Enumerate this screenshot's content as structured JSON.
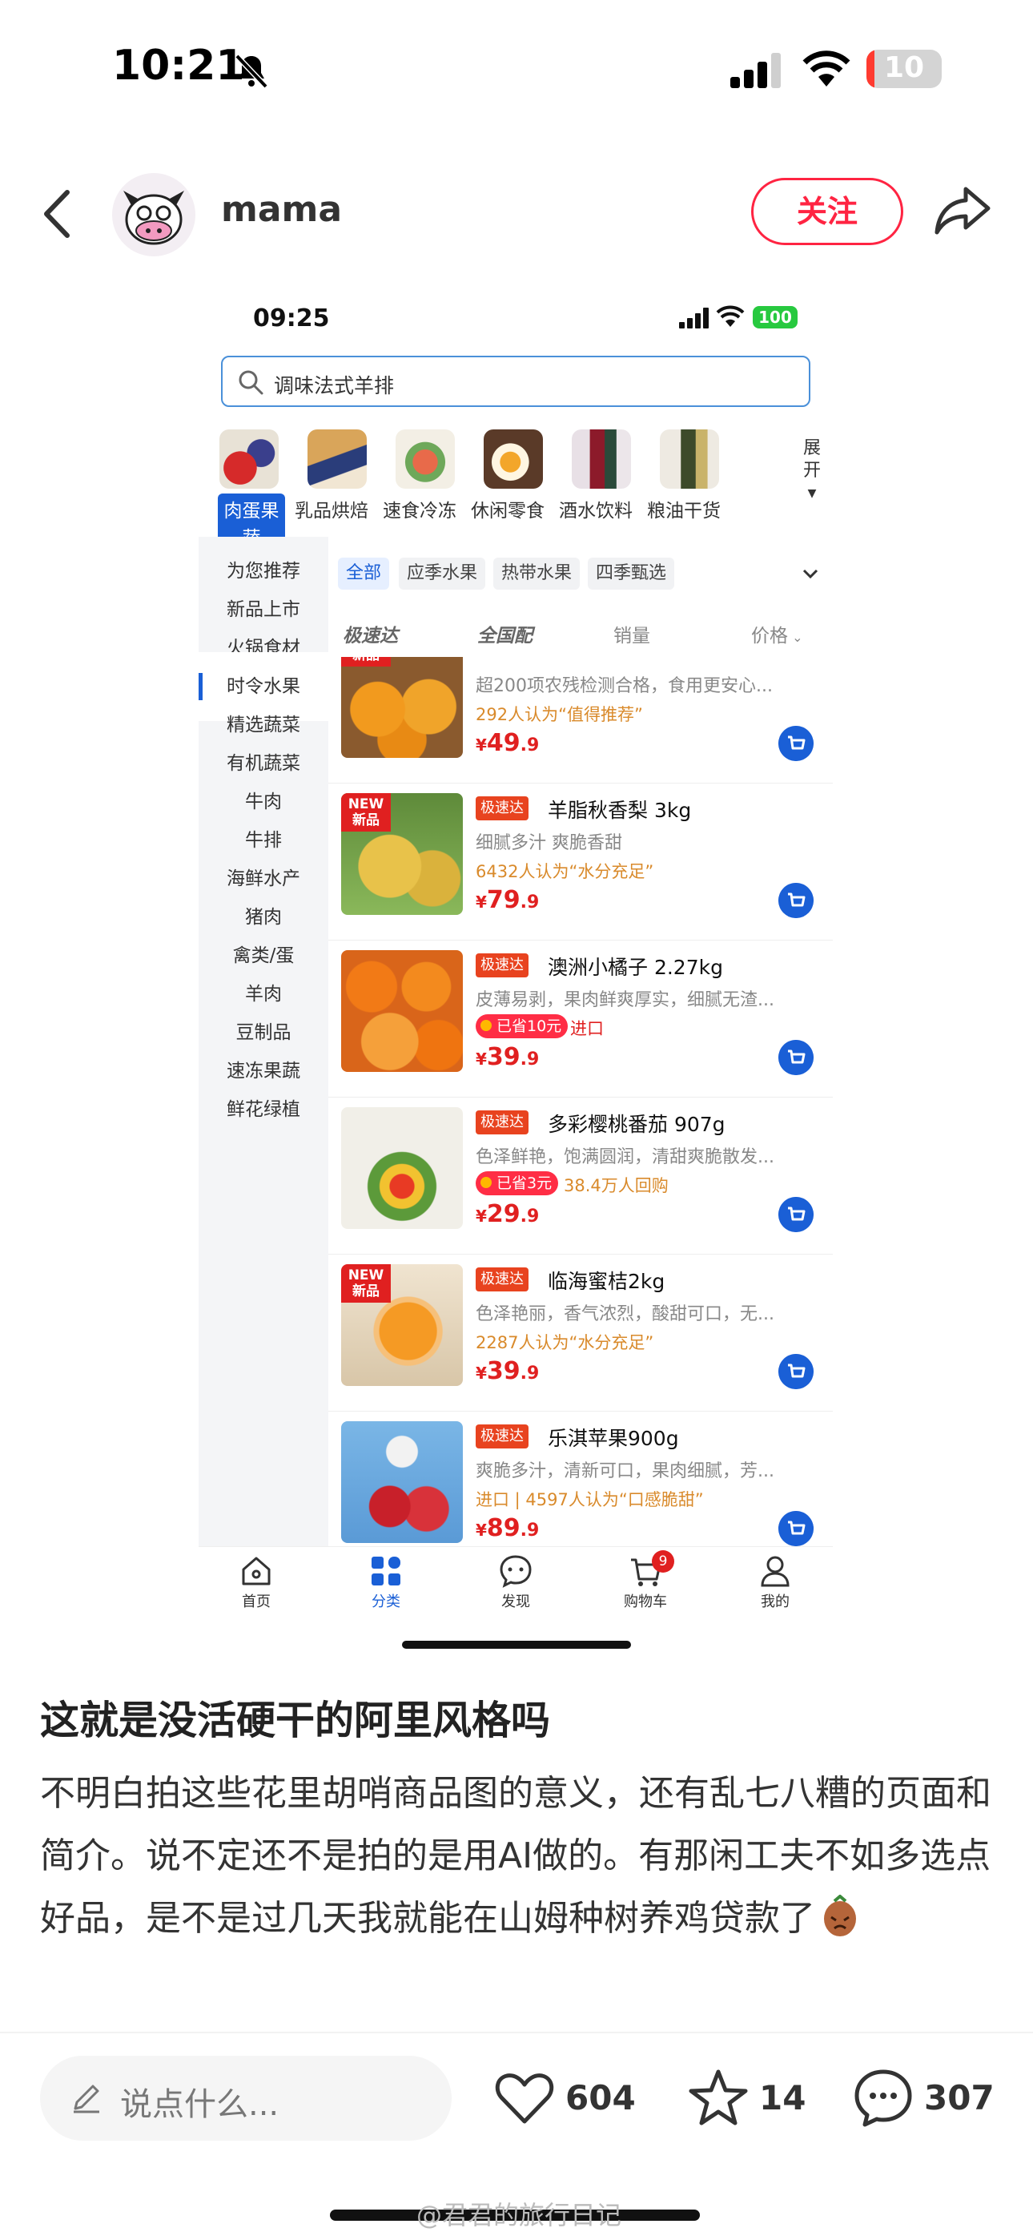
{
  "status_bar": {
    "time": "10:21",
    "battery": "10"
  },
  "post_header": {
    "username": "mama",
    "follow_label": "关注"
  },
  "screenshot": {
    "status": {
      "time": "09:25",
      "battery": "100"
    },
    "search": {
      "placeholder": "调味法式羊排"
    },
    "categories": [
      {
        "label": "肉蛋果蔬",
        "active": true
      },
      {
        "label": "乳品烘焙"
      },
      {
        "label": "速食冷冻"
      },
      {
        "label": "休闲零食"
      },
      {
        "label": "酒水饮料"
      },
      {
        "label": "粮油干货"
      }
    ],
    "expand_label": "展开",
    "sidebar": [
      "为您推荐",
      "新品上市",
      "火锅食材",
      "时令水果",
      "精选蔬菜",
      "有机蔬菜",
      "牛肉",
      "牛排",
      "海鲜水产",
      "猪肉",
      "禽类/蛋",
      "羊肉",
      "豆制品",
      "速冻果蔬",
      "鲜花绿植"
    ],
    "sidebar_active": "时令水果",
    "filters": [
      "全部",
      "应季水果",
      "热带水果",
      "四季甄选"
    ],
    "sorts": [
      "极速达",
      "全国配",
      "销量",
      "价格"
    ],
    "products": [
      {
        "badge": "",
        "name": "",
        "desc": "超200项农残检测合格，食用更安心...",
        "extra": "292人认为“值得推荐”",
        "price_int": "49",
        "price_dec": ".9",
        "new": true
      },
      {
        "badge": "极速达",
        "name": "羊脂秋香梨 3kg",
        "desc": "细腻多汁 爽脆香甜",
        "extra": "6432人认为“水分充足”",
        "price_int": "79",
        "price_dec": ".9",
        "new": true
      },
      {
        "badge": "极速达",
        "name": "澳洲小橘子 2.27kg",
        "desc": "皮薄易剥，果肉鲜爽厚实，细腻无渣...",
        "saved": "已省10元",
        "after": "进口",
        "price_int": "39",
        "price_dec": ".9"
      },
      {
        "badge": "极速达",
        "name": "多彩樱桃番茄 907g",
        "desc": "色泽鲜艳，饱满圆润，清甜爽脆散发...",
        "saved": "已省3元",
        "after": "38.4万人回购",
        "price_int": "29",
        "price_dec": ".9"
      },
      {
        "badge": "极速达",
        "name": "临海蜜桔2kg",
        "desc": "色泽艳丽，香气浓烈，酸甜可口，无...",
        "extra": "2287人认为“水分充足”",
        "price_int": "39",
        "price_dec": ".9",
        "new": true
      },
      {
        "badge": "极速达",
        "name": "乐淇苹果900g",
        "desc": "爽脆多汁，清新可口，果肉细腻，芳...",
        "extra": "进口 | 4597人认为“口感脆甜”",
        "price_int": "89",
        "price_dec": ".9"
      }
    ],
    "new_tag": "NEW\n新品",
    "price_symbol": "¥",
    "tabbar": [
      {
        "label": "首页"
      },
      {
        "label": "分类",
        "active": true
      },
      {
        "label": "发现"
      },
      {
        "label": "购物车",
        "badge": "9"
      },
      {
        "label": "我的"
      }
    ]
  },
  "post": {
    "title": "这就是没活硬干的阿里风格吗",
    "content": "不明白拍这些花里胡哨商品图的意义，还有乱七八糟的页面和简介。说不定还不是拍的是用AI做的。有那闲工夫不如多选点好品，是不是过几天我就能在山姆种树养鸡贷款了"
  },
  "bottom_bar": {
    "comment_placeholder": "说点什么...",
    "likes": "604",
    "stars": "14",
    "comments": "307"
  },
  "watermark": "@君君的旅行日记",
  "colors": {
    "accent": "#ff2442",
    "app_blue": "#1a5fd6",
    "price_red": "#e02020"
  }
}
